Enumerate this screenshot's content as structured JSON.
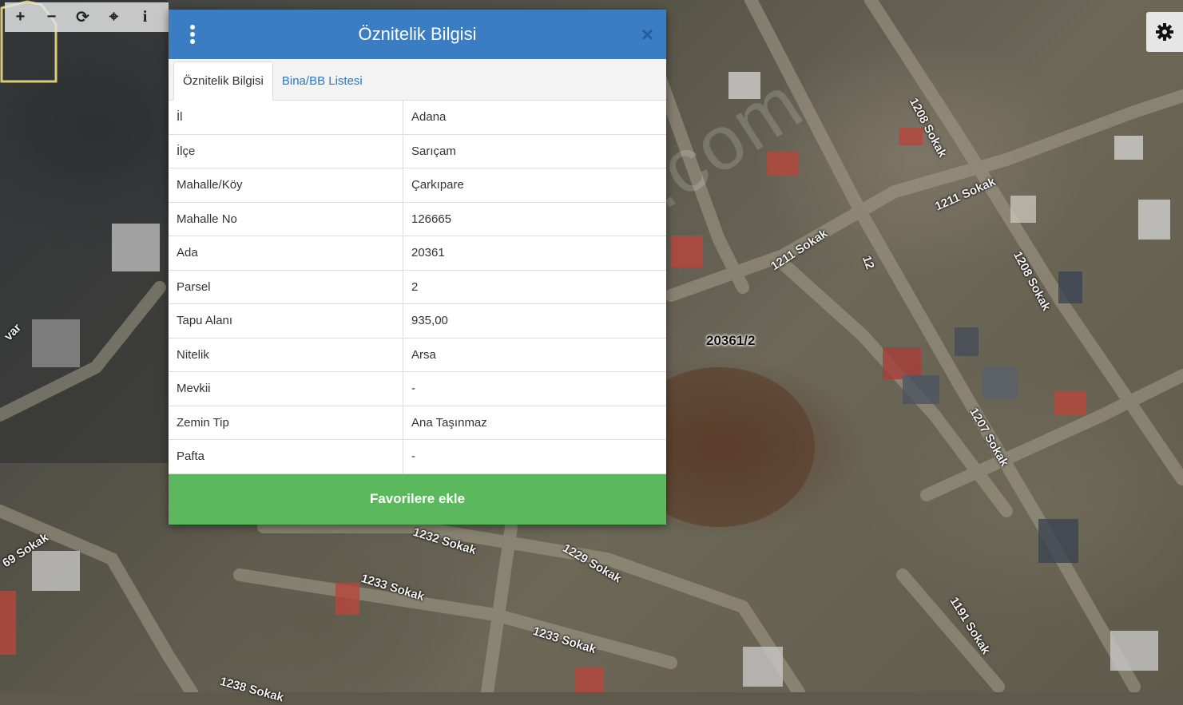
{
  "toolbar": {
    "items": [
      {
        "name": "zoom-in",
        "glyph": "+"
      },
      {
        "name": "zoom-out",
        "glyph": "−"
      },
      {
        "name": "refresh",
        "glyph": "⟳"
      },
      {
        "name": "locate",
        "glyph": "⌖"
      },
      {
        "name": "info",
        "glyph": "i"
      }
    ]
  },
  "dialog": {
    "title": "Öznitelik Bilgisi",
    "tabs": [
      {
        "label": "Öznitelik Bilgisi",
        "active": true
      },
      {
        "label": "Bina/BB Listesi",
        "active": false
      }
    ],
    "rows": [
      {
        "key": "İl",
        "value": "Adana"
      },
      {
        "key": "İlçe",
        "value": "Sarıçam"
      },
      {
        "key": "Mahalle/Köy",
        "value": "Çarkıpare"
      },
      {
        "key": "Mahalle No",
        "value": "126665"
      },
      {
        "key": "Ada",
        "value": "20361"
      },
      {
        "key": "Parsel",
        "value": "2"
      },
      {
        "key": "Tapu Alanı",
        "value": "935,00"
      },
      {
        "key": "Nitelik",
        "value": "Arsa"
      },
      {
        "key": "Mevkii",
        "value": "-"
      },
      {
        "key": "Zemin Tip",
        "value": "Ana Taşınmaz"
      },
      {
        "key": "Pafta",
        "value": "-"
      }
    ],
    "favorite_label": "Favorilere ekle"
  },
  "map": {
    "parcel_label": "20361/2",
    "watermark": "emlakjet.com",
    "streets": [
      {
        "label": "1208 Sokak"
      },
      {
        "label": "1211 Sokak"
      },
      {
        "label": "1211 Sokak"
      },
      {
        "label": "1208 Sokak"
      },
      {
        "label": "1207 Sokak"
      },
      {
        "label": "1232 Sokak"
      },
      {
        "label": "1229 Sokak"
      },
      {
        "label": "1233 Sokak"
      },
      {
        "label": "1233 Sokak"
      },
      {
        "label": "1191 Sokak"
      },
      {
        "label": "69 Sokak"
      },
      {
        "label": "1238 Sokak"
      },
      {
        "label": "var"
      },
      {
        "label": "12"
      }
    ]
  },
  "colors": {
    "header": "#3a7dc3",
    "favorite": "#5cb85c",
    "tab_link": "#2f77bb",
    "parcel_outline": "#d8cc7a"
  }
}
